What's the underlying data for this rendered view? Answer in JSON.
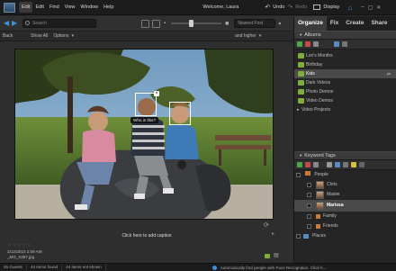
{
  "menubar": {
    "items": [
      "Edit",
      "Edit",
      "Find",
      "View",
      "Window",
      "Help"
    ],
    "active_index": 0,
    "welcome": "Welcome, Laura",
    "undo": "Undo",
    "redo": "Redo",
    "display": "Display"
  },
  "toolbar": {
    "search_placeholder": "Search",
    "sort_value": "Newest First",
    "and_higher": "and higher"
  },
  "subbar": {
    "back": "Back",
    "show_all": "Show All",
    "options": "Options"
  },
  "tabs": [
    "Organize",
    "Fix",
    "Create",
    "Share"
  ],
  "active_tab": "Organize",
  "albums": {
    "header": "Albums",
    "items": [
      {
        "label": "Lori's Months"
      },
      {
        "label": "Birthday"
      },
      {
        "label": "Kids",
        "selected": true
      },
      {
        "label": "Dark Videos"
      },
      {
        "label": "Photo Demos"
      },
      {
        "label": "Video Demos"
      }
    ],
    "group": "Video Projects"
  },
  "keyword_tags": {
    "header": "Keyword Tags",
    "root": "People",
    "people": [
      {
        "label": "Chris"
      },
      {
        "label": "Maisie"
      },
      {
        "label": "Marissa",
        "selected": true
      }
    ],
    "subgroups": [
      "Family",
      "Friends"
    ],
    "places": "Places"
  },
  "photo": {
    "face_tip": "Who is this?",
    "caption_prompt": "Click here to add caption",
    "date": "3/12/2010 2:09 AM",
    "filename": "_MG_0387.jpg",
    "rating_stars": 0
  },
  "status": {
    "people": "25 Guests",
    "items_found": "44 items found",
    "items_not_shown": "44 items not shown",
    "message": "Automatically find people with Face Recognition. Click h..."
  },
  "colors": {
    "accent_blue": "#3f8fd8",
    "album_green": "#7fae3a",
    "selection": "#4a4a4a"
  }
}
